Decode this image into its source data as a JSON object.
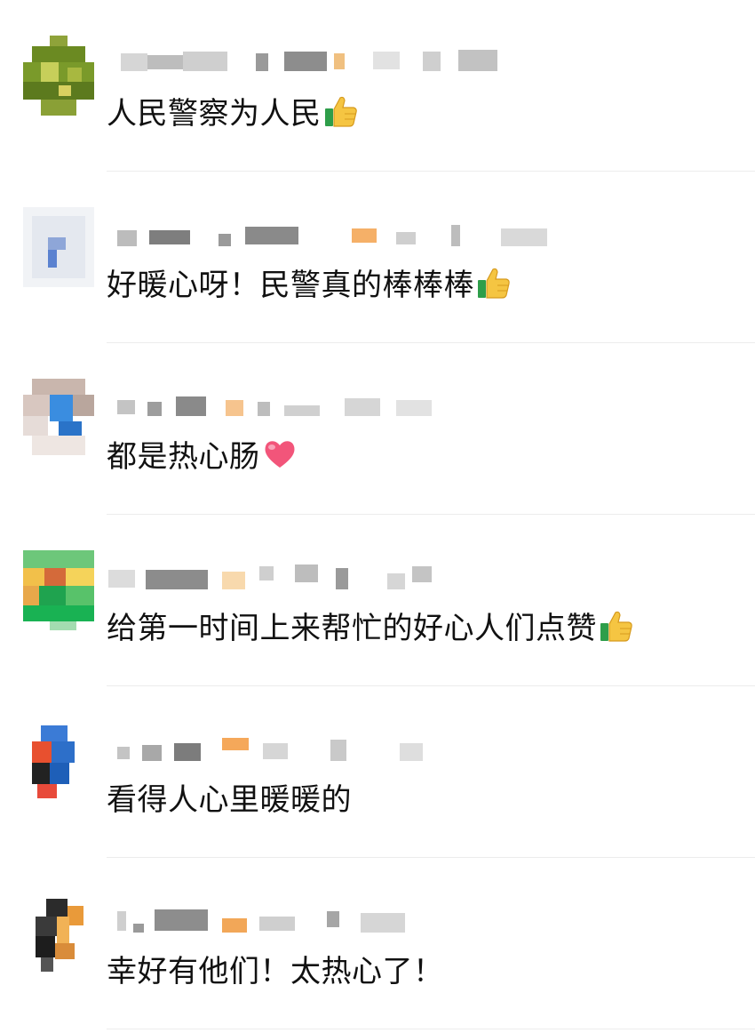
{
  "comments": [
    {
      "text": "人民警察为人民",
      "emoji": "thumbs-up-icon"
    },
    {
      "text": "好暖心呀！民警真的棒棒棒",
      "emoji": "thumbs-up-icon"
    },
    {
      "text": "都是热心肠",
      "emoji": "heart-icon"
    },
    {
      "text": "给第一时间上来帮忙的好心人们点赞",
      "emoji": "thumbs-up-icon"
    },
    {
      "text": "看得人心里暖暖的",
      "emoji": ""
    },
    {
      "text": "幸好有他们！太热心了！",
      "emoji": ""
    }
  ],
  "colors": {
    "text": "#111111",
    "divider": "#ececec",
    "blurred_name_gray": "#c8c8c8",
    "blurred_name_orange": "#f5b068"
  }
}
